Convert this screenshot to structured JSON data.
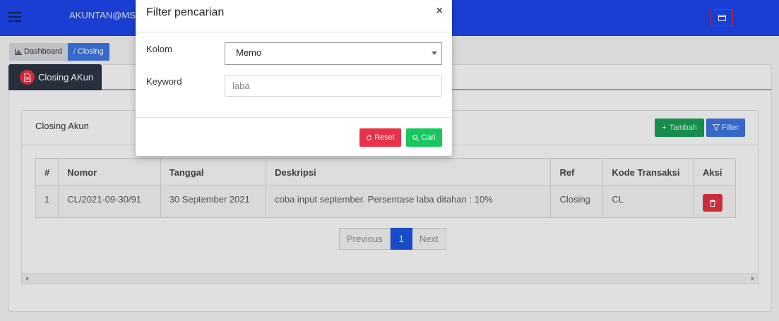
{
  "topbar": {
    "user": "AKUNTAN@MSE"
  },
  "breadcrumb": {
    "home": "Dashboard",
    "separator": "/",
    "current": "Closing"
  },
  "tab": {
    "label": "Closing AKun"
  },
  "card": {
    "title": "Closing Akun",
    "add_label": "Tambah",
    "filter_label": "Filter"
  },
  "table": {
    "headers": [
      "#",
      "Nomor",
      "Tanggal",
      "Deskripsi",
      "Ref",
      "Kode Transaksi",
      "Aksi"
    ],
    "rows": [
      {
        "no": "1",
        "nomor": "CL/2021-09-30/91",
        "tanggal": "30 September 2021",
        "deskripsi": "coba input september. Persentase laba ditahan : 10%",
        "ref": "Closing",
        "kode": "CL"
      }
    ]
  },
  "pagination": {
    "previous": "Previous",
    "current": "1",
    "next": "Next"
  },
  "modal": {
    "title": "Filter pencarian",
    "close": "×",
    "kolom_label": "Kolom",
    "kolom_value": "Memo",
    "keyword_label": "Keyword",
    "keyword_placeholder": "laba",
    "reset_label": "Reset",
    "cari_label": "Cari"
  },
  "colors": {
    "topbar": "#1d44e3",
    "primary": "#3b72d8",
    "success": "#1a9a52",
    "danger": "#e8314a",
    "search": "#18c85f"
  },
  "icons": [
    "menu-icon",
    "window-icon",
    "bar-chart-icon",
    "document-icon",
    "plus-icon",
    "funnel-icon",
    "trash-icon",
    "refresh-icon",
    "search-icon",
    "close-icon"
  ]
}
